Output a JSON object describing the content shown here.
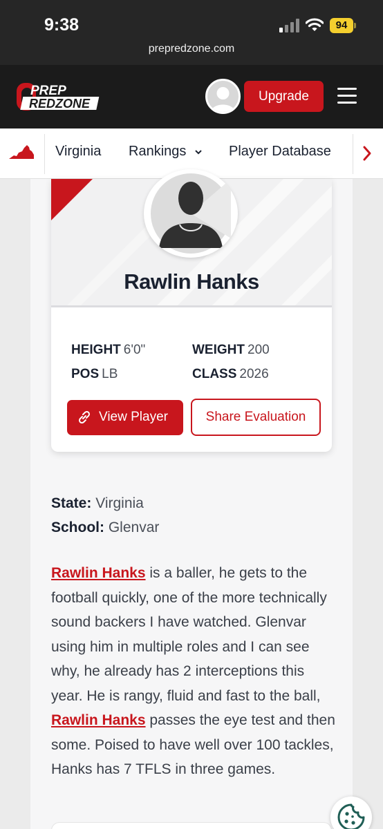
{
  "status_bar": {
    "time": "9:38",
    "battery": "94",
    "url": "prepredzone.com"
  },
  "header": {
    "logo_top": "PREP",
    "logo_bottom": "REDZONE",
    "upgrade_label": "Upgrade"
  },
  "nav": {
    "state": "Virginia",
    "rankings": "Rankings",
    "player_database": "Player Database"
  },
  "player": {
    "name": "Rawlin Hanks",
    "height_label": "HEIGHT",
    "height": "6'0\"",
    "weight_label": "WEIGHT",
    "weight": "200",
    "pos_label": "POS",
    "pos": "LB",
    "class_label": "CLASS",
    "class": "2026"
  },
  "actions": {
    "view_player": "View Player",
    "share_evaluation": "Share Evaluation"
  },
  "info": {
    "state_label": "State:",
    "state": "Virginia",
    "school_label": "School:",
    "school": "Glenvar"
  },
  "article": {
    "link_name": "Rawlin Hanks",
    "text_1": " is a baller, he gets to the football quickly, one of the more technically sound backers I have watched. Glenvar using him in multiple roles and I can see why, he already has 2 interceptions this year. He is rangy, fluid and fast to the ball, ",
    "text_2": " passes the eye test and then some. Poised to have well over 100 tackles, Hanks has 7 TFLS in three games."
  },
  "colors": {
    "brand_red": "#c8161d",
    "header_bg": "#1b1b1b",
    "status_bg": "#262626",
    "text": "#1a2130"
  },
  "icons": [
    "signal-icon",
    "wifi-icon",
    "battery-icon",
    "virginia-map-icon",
    "chevron-down-icon",
    "chevron-right-icon",
    "link-icon",
    "cookie-icon",
    "menu-icon",
    "avatar-icon"
  ]
}
